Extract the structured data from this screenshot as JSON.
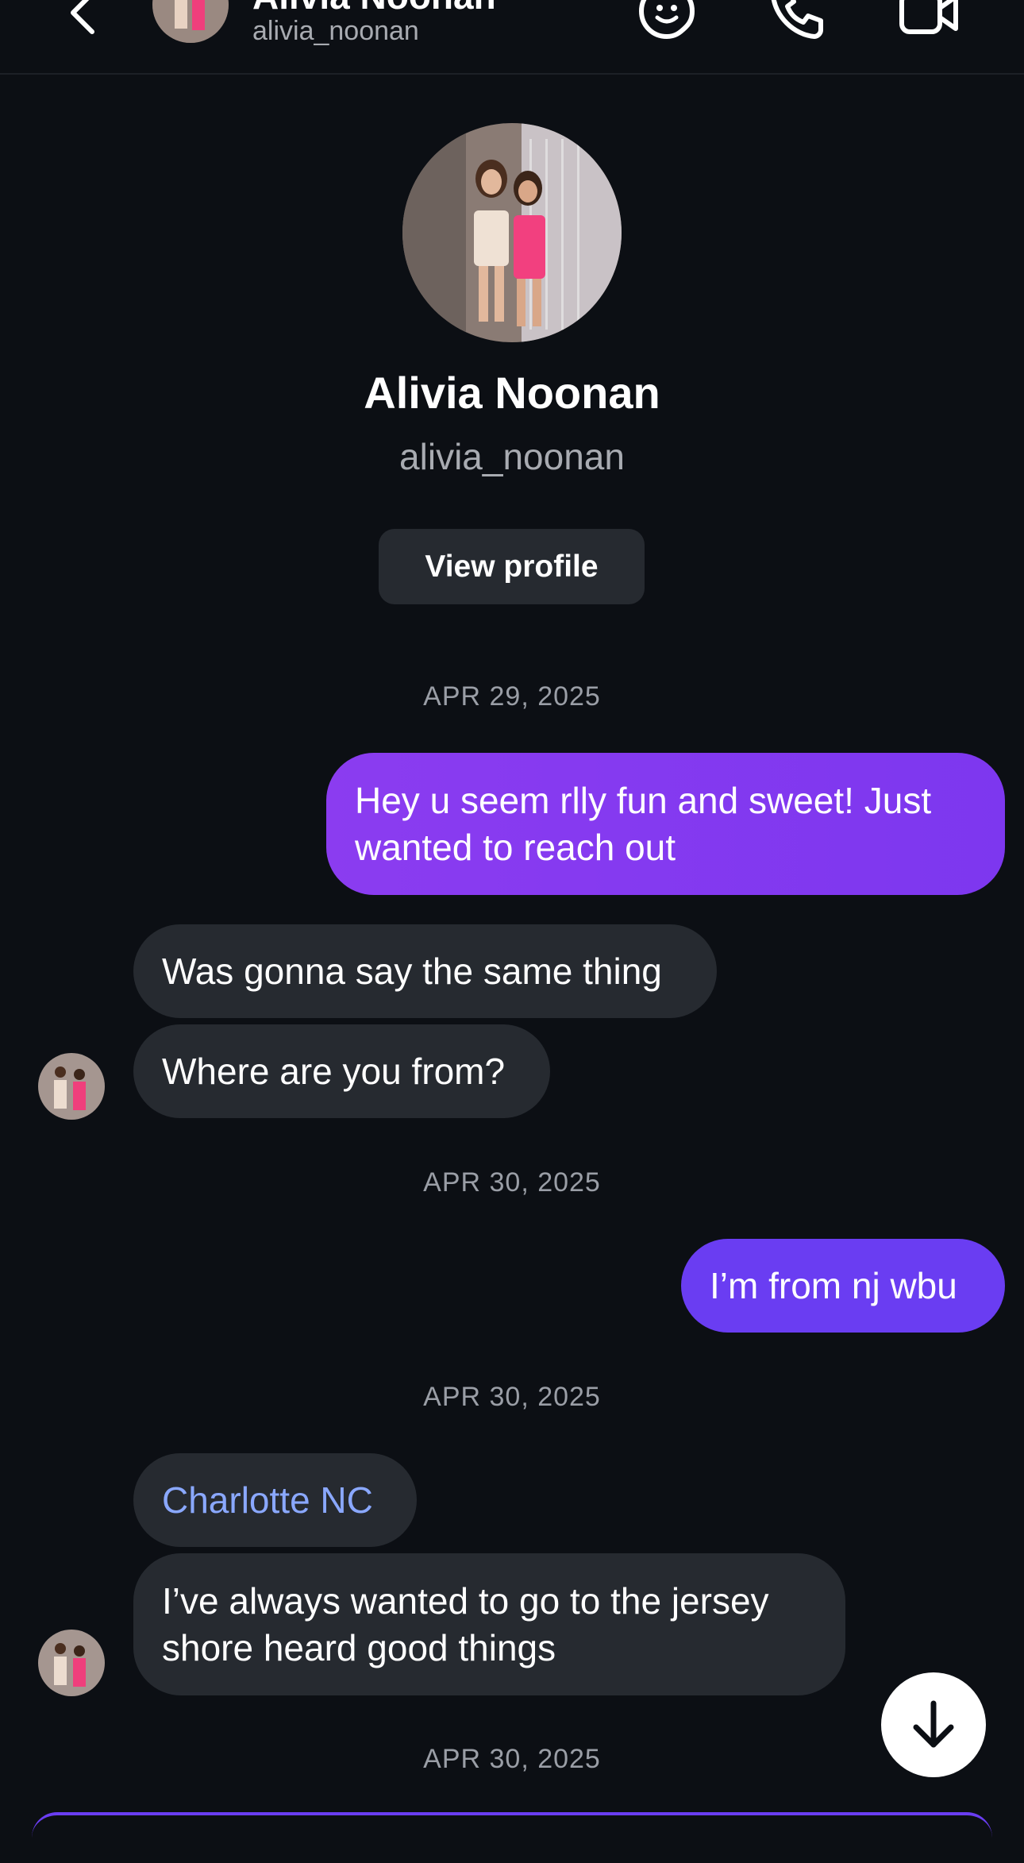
{
  "header": {
    "name": "Alivia Noonan",
    "username": "alivia_noonan",
    "icons": [
      "back-icon",
      "sticker-icon",
      "phone-icon",
      "video-icon"
    ]
  },
  "profile": {
    "name": "Alivia Noonan",
    "username": "alivia_noonan",
    "view_profile_label": "View profile"
  },
  "dates": {
    "d1": "APR 29, 2025",
    "d2": "APR 30, 2025",
    "d3": "APR 30, 2025",
    "d4": "APR 30, 2025"
  },
  "messages": [
    {
      "from": "me",
      "text": "Hey u seem rlly fun and sweet! Just wanted to reach out"
    },
    {
      "from": "them",
      "text": "Was gonna say the same thing"
    },
    {
      "from": "them",
      "text": "Where are you from?"
    },
    {
      "from": "me",
      "text": "I’m from nj wbu"
    },
    {
      "from": "them",
      "text": "Charlotte NC"
    },
    {
      "from": "them",
      "text": "I’ve always wanted to go to the jersey shore heard good things"
    }
  ],
  "colors": {
    "background": "#0c0f14",
    "outgoing_purple": "#8b3cf0",
    "outgoing_indigo": "#6a3df2",
    "incoming": "#262a30",
    "link": "#8aa8ff"
  }
}
